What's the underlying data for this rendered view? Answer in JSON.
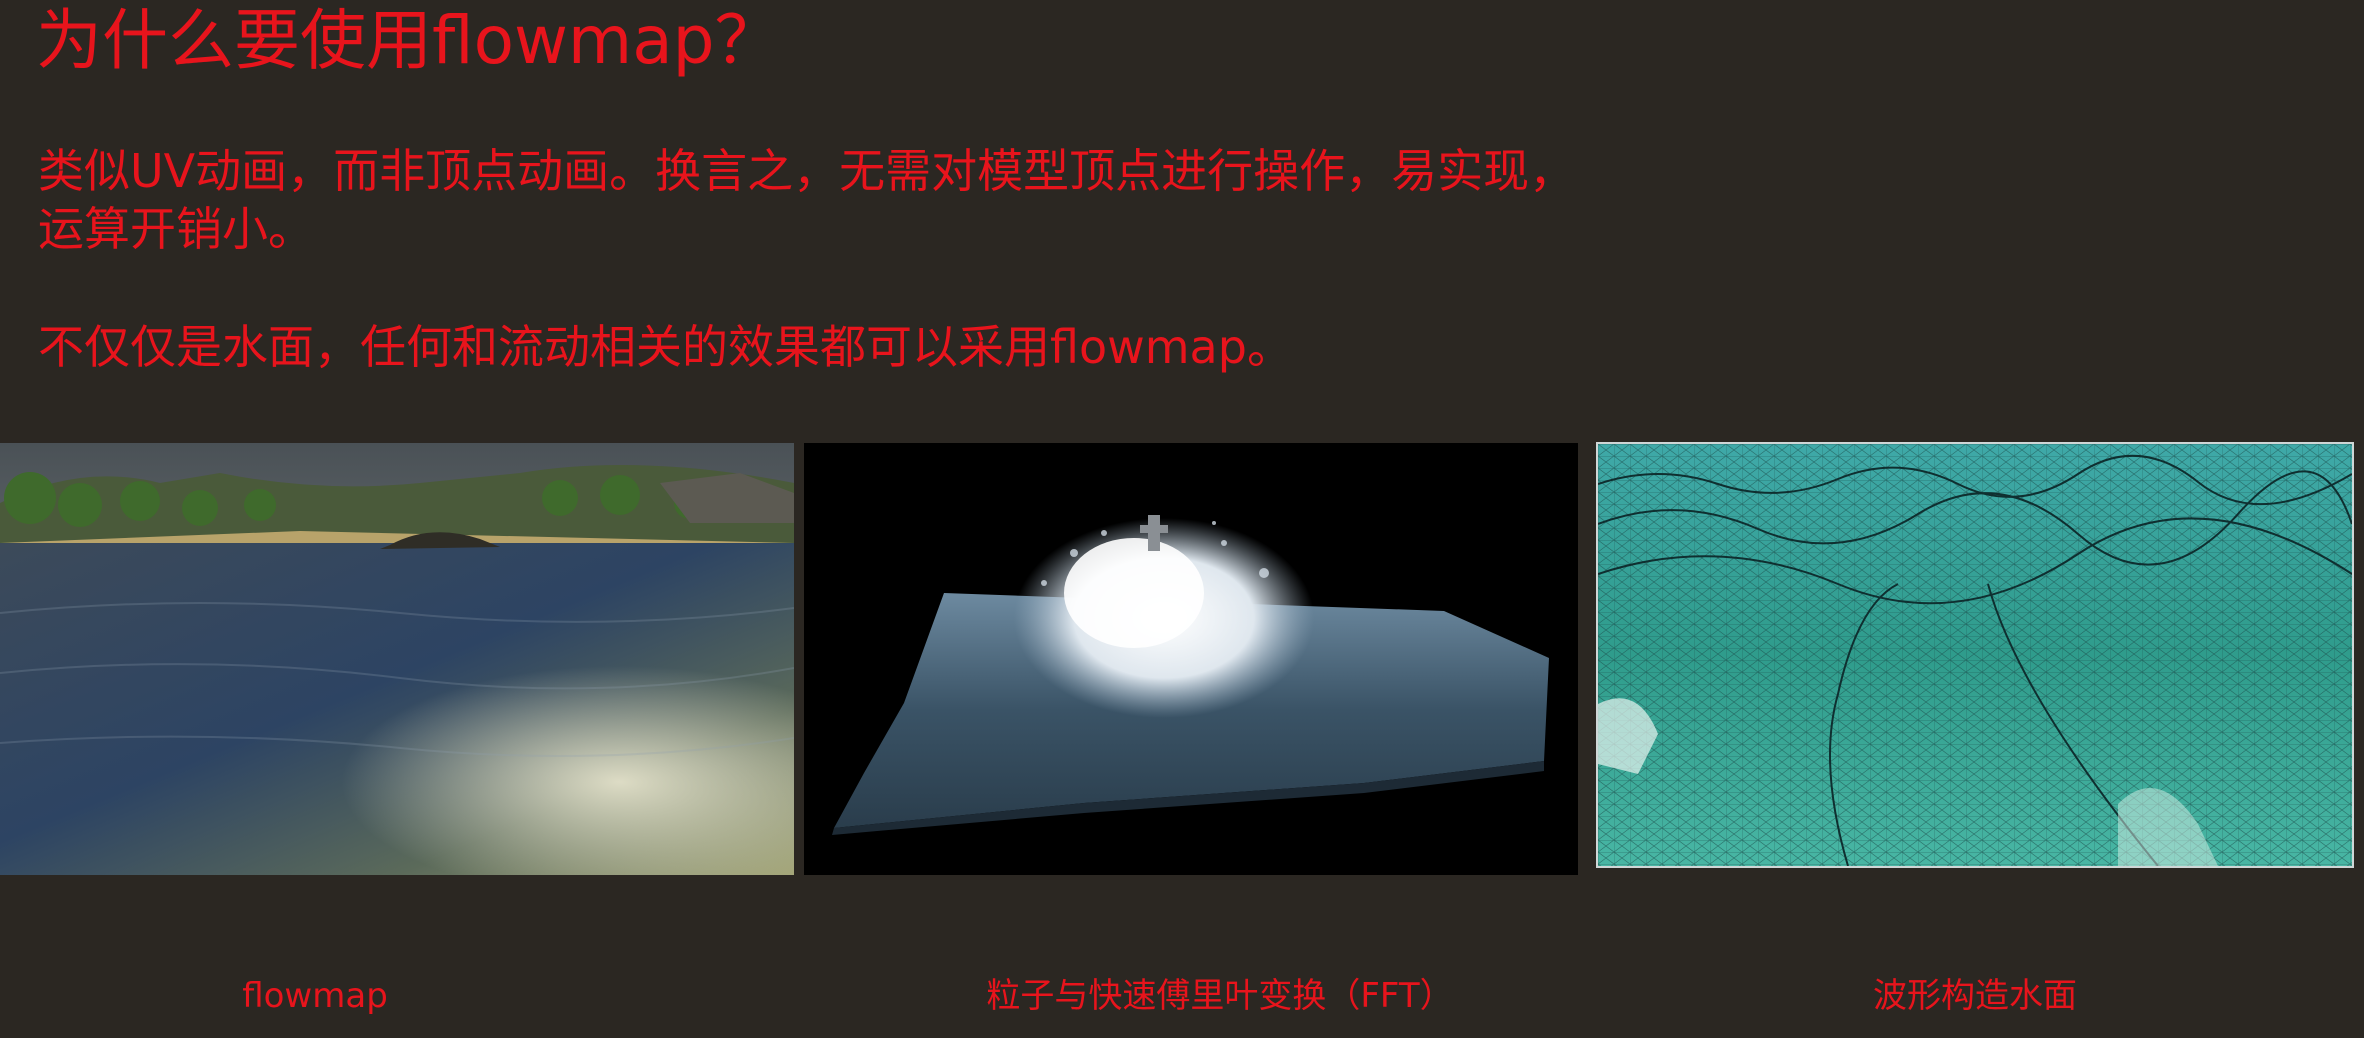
{
  "slide": {
    "title": "为什么要使用flowmap？",
    "paragraph1_line1": "类似UV动画，而非顶点动画。换言之，无需对模型顶点进行操作，易实现，",
    "paragraph1_line2": "运算开销小。",
    "paragraph2": "不仅仅是水面，任何和流动相关的效果都可以采用flowmap。",
    "text_color": "#e8141c",
    "background_color": "#2b2722"
  },
  "images": [
    {
      "caption": "flowmap",
      "icon": "river-water-scene"
    },
    {
      "caption": "粒子与快速傅里叶变换（FFT）",
      "icon": "ocean-splash-fft-scene"
    },
    {
      "caption": "波形构造水面",
      "icon": "wave-mesh-scene"
    }
  ]
}
